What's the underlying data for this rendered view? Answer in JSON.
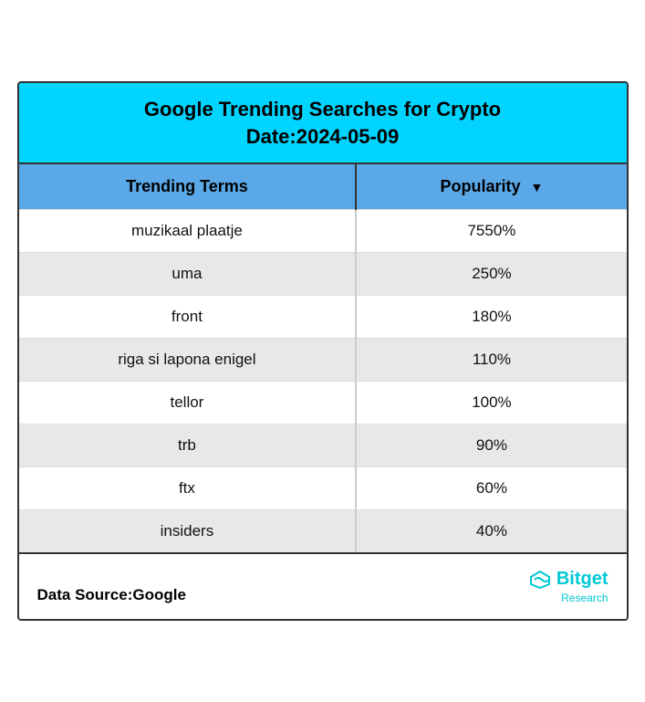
{
  "header": {
    "title_line1": "Google Trending Searches for Crypto",
    "title_line2": "Date:2024-05-09"
  },
  "table": {
    "col1_header": "Trending Terms",
    "col2_header": "Popularity",
    "rows": [
      {
        "term": "muzikaal plaatje",
        "popularity": "7550%"
      },
      {
        "term": "uma",
        "popularity": "250%"
      },
      {
        "term": "front",
        "popularity": "180%"
      },
      {
        "term": "riga si lapona enigel",
        "popularity": "110%"
      },
      {
        "term": "tellor",
        "popularity": "100%"
      },
      {
        "term": "trb",
        "popularity": "90%"
      },
      {
        "term": "ftx",
        "popularity": "60%"
      },
      {
        "term": "insiders",
        "popularity": "40%"
      }
    ]
  },
  "footer": {
    "source_label": "Data Source:Google",
    "brand_name": "Bitget",
    "brand_sub": "Research"
  },
  "colors": {
    "header_bg": "#00d4ff",
    "col_header_bg": "#5ba8e8",
    "brand_color": "#00c8d4"
  }
}
